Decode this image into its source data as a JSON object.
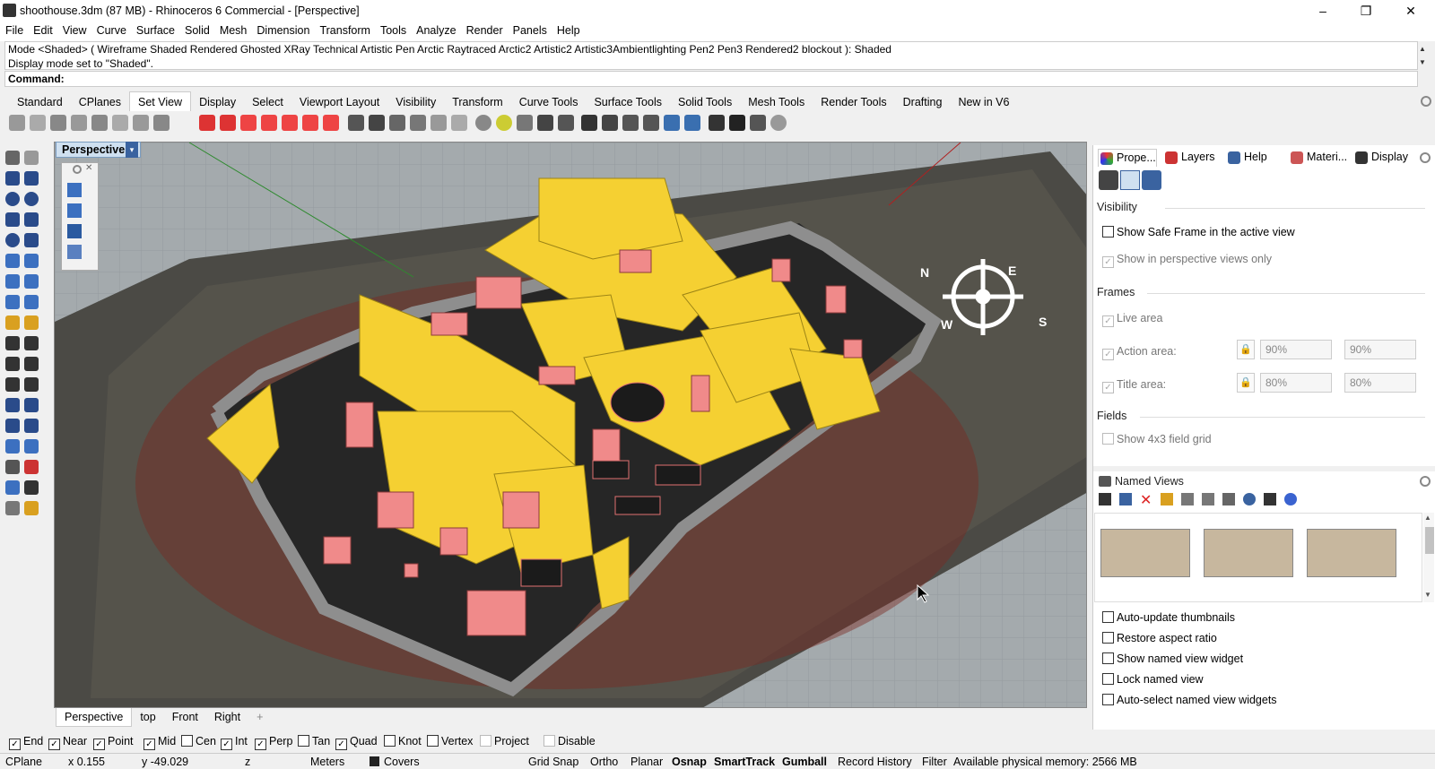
{
  "window": {
    "title": "shoothouse.3dm (87 MB) - Rhinoceros 6 Commercial - [Perspective]",
    "minimize": "–",
    "maximize": "❐",
    "close": "✕"
  },
  "menu": [
    "File",
    "Edit",
    "View",
    "Curve",
    "Surface",
    "Solid",
    "Mesh",
    "Dimension",
    "Transform",
    "Tools",
    "Analyze",
    "Render",
    "Panels",
    "Help"
  ],
  "command": {
    "history_line1": "Mode <Shaded> ( Wireframe  Shaded  Rendered  Ghosted  XRay  Technical  Artistic  Pen  Arctic  Raytraced  Arctic2  Artistic2  Artistic3Ambientlighting  Pen2  Pen3  Rendered2  blockout ): Shaded",
    "history_line2": "Display mode set to \"Shaded\".",
    "prompt": "Command:"
  },
  "toolbar_tabs": [
    "Standard",
    "CPlanes",
    "Set View",
    "Display",
    "Select",
    "Viewport Layout",
    "Visibility",
    "Transform",
    "Curve Tools",
    "Surface Tools",
    "Solid Tools",
    "Mesh Tools",
    "Render Tools",
    "Drafting",
    "New in V6"
  ],
  "toolbar_active_tab": "Set View",
  "viewport": {
    "name": "Perspective",
    "menu_arrow": "▾",
    "compass": {
      "N": "N",
      "E": "E",
      "S": "S",
      "W": "W"
    }
  },
  "view_tabs": [
    "Perspective",
    "top",
    "Front",
    "Right"
  ],
  "view_tab_add": "+",
  "osnaps": [
    {
      "label": "End",
      "checked": true
    },
    {
      "label": "Near",
      "checked": true
    },
    {
      "label": "Point",
      "checked": true
    },
    {
      "label": "Mid",
      "checked": true
    },
    {
      "label": "Cen",
      "checked": false
    },
    {
      "label": "Int",
      "checked": true
    },
    {
      "label": "Perp",
      "checked": true
    },
    {
      "label": "Tan",
      "checked": false
    },
    {
      "label": "Quad",
      "checked": true
    },
    {
      "label": "Knot",
      "checked": false
    },
    {
      "label": "Vertex",
      "checked": false
    },
    {
      "label": "Project",
      "checked": false,
      "disabled": true
    },
    {
      "label": "Disable",
      "checked": false,
      "disabled": true
    }
  ],
  "status": {
    "cplane": "CPlane",
    "x": "x 0.155",
    "y": "y -49.029",
    "z": "z",
    "units": "Meters",
    "layer": "Covers",
    "grid_snap": "Grid Snap",
    "ortho": "Ortho",
    "planar": "Planar",
    "osnap": "Osnap",
    "smarttrack": "SmartTrack",
    "gumball": "Gumball",
    "record_history": "Record History",
    "filter": "Filter",
    "memory": "Available physical memory: 2566 MB"
  },
  "panel": {
    "tabs": [
      "Prope...",
      "Layers",
      "Help",
      "Materi...",
      "Display"
    ],
    "visibility_header": "Visibility",
    "show_safe_frame": "Show Safe Frame in the active view",
    "show_in_perspective": "Show in perspective views only",
    "frames_header": "Frames",
    "live_area": "Live area",
    "action_area": "Action area:",
    "action_w": "90%",
    "action_h": "90%",
    "title_area": "Title area:",
    "title_w": "80%",
    "title_h": "80%",
    "fields_header": "Fields",
    "show_field_grid": "Show 4x3 field grid",
    "named_views_header": "Named Views",
    "nv_options": [
      "Auto-update thumbnails",
      "Restore aspect ratio",
      "Show named view widget",
      "Lock named view",
      "Auto-select named view widgets"
    ]
  },
  "colors": {
    "yellow_building": "#f5d032",
    "pink_block": "#f08a8a",
    "wall_gray": "#8e8e8e",
    "accent_blue": "#3a63a0",
    "floor_dark": "#2b2b2b"
  }
}
